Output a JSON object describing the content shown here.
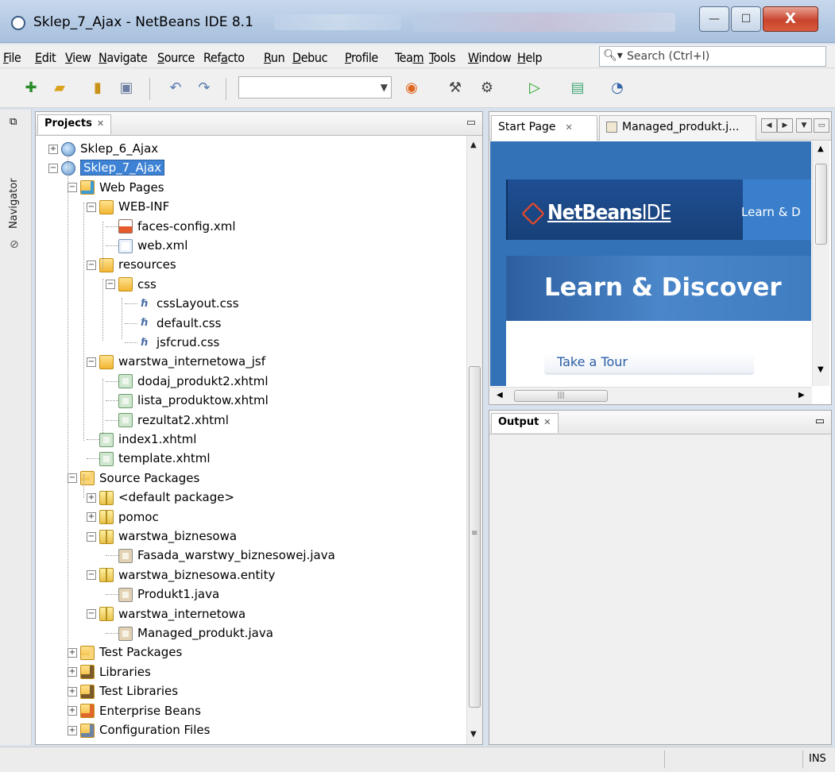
{
  "window": {
    "title": "Sklep_7_Ajax - NetBeans IDE 8.1",
    "btn_min": "—",
    "btn_max": "☐",
    "btn_close": "X"
  },
  "menu": [
    {
      "label": "File",
      "u": "F",
      "rest": "ile"
    },
    {
      "label": "Edit",
      "u": "E",
      "rest": "dit"
    },
    {
      "label": "View",
      "u": "V",
      "rest": "iew"
    },
    {
      "label": "Navigate",
      "u": "N",
      "rest": "avigate"
    },
    {
      "label": "Source",
      "u": "S",
      "rest": "ource"
    },
    {
      "label": "Refacto",
      "u": "",
      "pre": "Ref",
      "uc": "a",
      "rest": "cto"
    },
    {
      "label": "Run",
      "u": "R",
      "rest": "un"
    },
    {
      "label": "Debug",
      "u": "D",
      "rest": "ebuc"
    },
    {
      "label": "Profile",
      "u": "P",
      "rest": "rofile"
    },
    {
      "label": "Team",
      "pre": "Tea",
      "uc": "m",
      "rest": ""
    },
    {
      "label": "Tools",
      "u": "T",
      "rest": "ools"
    },
    {
      "label": "Window",
      "u": "W",
      "rest": "indow"
    },
    {
      "label": "Help",
      "u": "H",
      "rest": "elp"
    }
  ],
  "search": {
    "placeholder": "Search (Ctrl+I)"
  },
  "toolbar": {
    "icons": [
      "new-project-icon",
      "new-file-icon",
      "open-project-icon",
      "save-all-icon",
      "undo-icon",
      "redo-icon",
      "browser-icon",
      "clean-build-icon",
      "build-icon",
      "run-icon",
      "debug-icon",
      "profile-icon"
    ],
    "config_value": ""
  },
  "side": {
    "navigator_label": "Navigator"
  },
  "projects": {
    "tab_label": "Projects",
    "tree": [
      {
        "label": "Sklep_6_Ajax",
        "icon": "globe",
        "level": 0,
        "exp": "+"
      },
      {
        "label": "Sklep_7_Ajax",
        "icon": "globe",
        "level": 0,
        "exp": "−",
        "selected": true
      },
      {
        "label": "Web Pages",
        "icon": "folderweb",
        "level": 1,
        "exp": "−"
      },
      {
        "label": "WEB-INF",
        "icon": "folder",
        "level": 2,
        "exp": "−"
      },
      {
        "label": "faces-config.xml",
        "icon": "jsp",
        "level": 3
      },
      {
        "label": "web.xml",
        "icon": "file",
        "level": 3
      },
      {
        "label": "resources",
        "icon": "folder",
        "level": 2,
        "exp": "−"
      },
      {
        "label": "css",
        "icon": "folder",
        "level": 3,
        "exp": "−"
      },
      {
        "label": "cssLayout.css",
        "icon": "css",
        "level": 4
      },
      {
        "label": "default.css",
        "icon": "css",
        "level": 4
      },
      {
        "label": "jsfcrud.css",
        "icon": "css",
        "level": 4
      },
      {
        "label": "warstwa_internetowa_jsf",
        "icon": "folder",
        "level": 2,
        "exp": "−"
      },
      {
        "label": "dodaj_produkt2.xhtml",
        "icon": "xhtml",
        "level": 3
      },
      {
        "label": "lista_produktow.xhtml",
        "icon": "xhtml",
        "level": 3
      },
      {
        "label": "rezultat2.xhtml",
        "icon": "xhtml",
        "level": 3
      },
      {
        "label": "index1.xhtml",
        "icon": "xhtml",
        "level": 2
      },
      {
        "label": "template.xhtml",
        "icon": "xhtml",
        "level": 2
      },
      {
        "label": "Source Packages",
        "icon": "pkgsrc",
        "level": 1,
        "exp": "−"
      },
      {
        "label": "<default package>",
        "icon": "pkg",
        "level": 2,
        "exp": "+"
      },
      {
        "label": "pomoc",
        "icon": "pkg",
        "level": 2,
        "exp": "+"
      },
      {
        "label": "warstwa_biznesowa",
        "icon": "pkg",
        "level": 2,
        "exp": "−"
      },
      {
        "label": "Fasada_warstwy_biznesowej.java",
        "icon": "java",
        "level": 3
      },
      {
        "label": "warstwa_biznesowa.entity",
        "icon": "pkg",
        "level": 2,
        "exp": "−"
      },
      {
        "label": "Produkt1.java",
        "icon": "java",
        "level": 3
      },
      {
        "label": "warstwa_internetowa",
        "icon": "pkg",
        "level": 2,
        "exp": "−"
      },
      {
        "label": "Managed_produkt.java",
        "icon": "java",
        "level": 3
      },
      {
        "label": "Test Packages",
        "icon": "pkgsrc",
        "level": 1,
        "exp": "+"
      },
      {
        "label": "Libraries",
        "icon": "lib",
        "level": 1,
        "exp": "+"
      },
      {
        "label": "Test Libraries",
        "icon": "lib",
        "level": 1,
        "exp": "+"
      },
      {
        "label": "Enterprise Beans",
        "icon": "ejb",
        "level": 1,
        "exp": "+"
      },
      {
        "label": "Configuration Files",
        "icon": "cfg",
        "level": 1,
        "exp": "+"
      }
    ]
  },
  "editor": {
    "tabs": [
      {
        "label": "Start Page"
      },
      {
        "label": "Managed_produkt.j..."
      }
    ],
    "start_page": {
      "logo": "NetBeans",
      "logo_suffix": "IDE",
      "header_link": "Learn & D",
      "section_title": "Learn & Discover",
      "tour_link": "Take a Tour"
    }
  },
  "output": {
    "tab_label": "Output"
  },
  "status": {
    "mode": "INS"
  }
}
